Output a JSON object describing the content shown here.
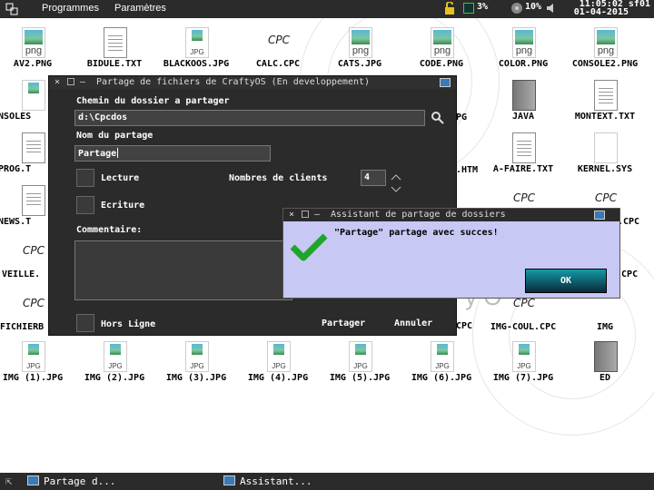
{
  "topbar": {
    "menu_programmes": "Programmes",
    "menu_parametres": "Paramètres",
    "cpu": "3%",
    "battery": "10%",
    "time": "11:05:02",
    "date": "01-04-2015",
    "user": "sf01"
  },
  "desktop_icons": {
    "av2": "AV2.PNG",
    "png_ext": "png",
    "jpg_ext": "JPG",
    "cpc_glyph": "CPC",
    "bidule": "BIDULE.TXT",
    "blackoos": "BLACKOOS.JPG",
    "calc": "CALC.CPC",
    "cats": "CATS.JPG",
    "code": "CODE.PNG",
    "color": "COLOR.PNG",
    "console2": "CONSOLE2.PNG",
    "consoles": "CONSOLES",
    "java": "JAVA",
    "montext": "MONTEXT.TXT",
    "prog": "PROG.T",
    "htm": ".HTM",
    "afaire": "A-FAIRE.TXT",
    "kernel": "KERNEL.SYS",
    "news": "NEWS.T",
    "veille": "VEILLE.",
    "xcpc1": ".CPC",
    "xcpc2": "R.CPC",
    "fichierb": "FICHIERB",
    "xcpc3": "CPC",
    "imgcoul": "IMG-COUL.CPC",
    "img": "IMG",
    "img1": "IMG (1).JPG",
    "img2": "IMG (2).JPG",
    "img3": "IMG (3).JPG",
    "img4": "IMG (4).JPG",
    "img5": "IMG (5).JPG",
    "img6": "IMG (6).JPG",
    "img7": "IMG (7).JPG",
    "ed": "ED",
    "frag_pg": "PG",
    "frag_os": "y O"
  },
  "share_dialog": {
    "title": "Partage de fichiers de CraftyOS (En developpement)",
    "path_label": "Chemin du dossier a partager",
    "path_value": "d:\\Cpcdos",
    "name_label": "Nom du partage",
    "name_value": "Partage",
    "read_label": "Lecture",
    "clients_label": "Nombres de clients",
    "clients_value": "4",
    "write_label": "Ecriture",
    "comment_label": "Commentaire:",
    "offline_label": "Hors Ligne",
    "share_button": "Partager",
    "cancel_button": "Annuler"
  },
  "assistant_dialog": {
    "title": "Assistant de partage de dossiers",
    "message": "\"Partage\" partage avec succes!",
    "ok_label": "OK"
  },
  "taskbar": {
    "task1": "Partage d...",
    "task2": "Assistant..."
  },
  "colors": {
    "bar_bg": "#2b2b2b",
    "assistant_bg": "#c8c8f5",
    "check_green": "#1fa52a",
    "ok_button": "#149ba8"
  }
}
